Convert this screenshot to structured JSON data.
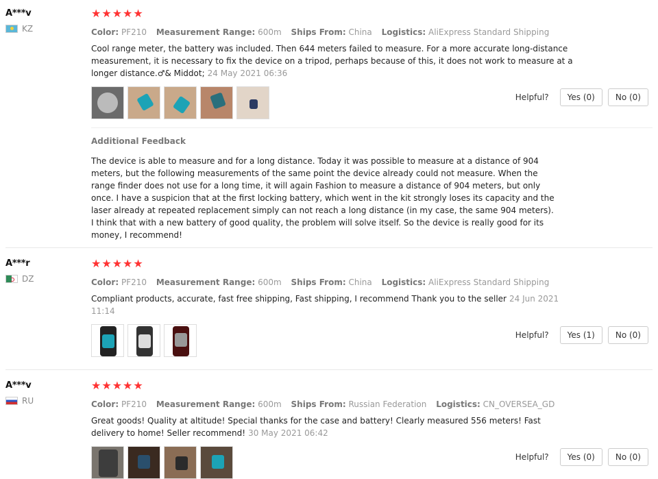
{
  "labels": {
    "color": "Color:",
    "range": "Measurement Range:",
    "ships": "Ships From:",
    "logistics": "Logistics:",
    "helpful": "Helpful?",
    "additional": "Additional Feedback"
  },
  "reviews": [
    {
      "user": "A***v",
      "country": "KZ",
      "stars": "★★★★★",
      "color": "PF210",
      "range": "600m",
      "ships": "China",
      "logistics": "AliExpress Standard Shipping",
      "text": "Cool range meter, the battery was included. Then 644 meters failed to measure. For a more accurate long-distance measurement, it is necessary to fix the device on a tripod, perhaps because of this, it does not work to measure at a longer distance.♂& Middot;",
      "date": "24 May 2021 06:36",
      "yes": "Yes (0)",
      "no": "No (0)",
      "additional_text": "The device is able to measure and for a long distance. Today it was possible to measure at a distance of 904 meters, but the following measurements of the same point the device already could not measure. When the range finder does not use for a long time, it will again Fashion to measure a distance of 904 meters, but only once. I have a suspicion that at the first locking battery, which went in the kit strongly loses its capacity and the laser already at repeated replacement simply can not reach a long distance (in my case, the same 904 meters). I think that with a new battery of good quality, the problem will solve itself. So the device is really good for its money, I recommend!"
    },
    {
      "user": "A***r",
      "country": "DZ",
      "stars": "★★★★★",
      "color": "PF210",
      "range": "600m",
      "ships": "China",
      "logistics": "AliExpress Standard Shipping",
      "text": "Compliant products, accurate, fast free shipping, Fast shipping, I recommend Thank you to the seller",
      "date": "24 Jun 2021 11:14",
      "yes": "Yes (1)",
      "no": "No (0)"
    },
    {
      "user": "A***v",
      "country": "RU",
      "stars": "★★★★★",
      "color": "PF210",
      "range": "600m",
      "ships": "Russian Federation",
      "logistics": "CN_OVERSEA_GD",
      "text": "Great goods! Quality at altitude! Special thanks for the case and battery! Clearly measured 556 meters! Fast delivery to home! Seller recommend!",
      "date": "30 May 2021 06:42",
      "yes": "Yes (0)",
      "no": "No (0)"
    }
  ],
  "colors": {
    "star": "#ff3333",
    "meta_value": "#999999"
  }
}
